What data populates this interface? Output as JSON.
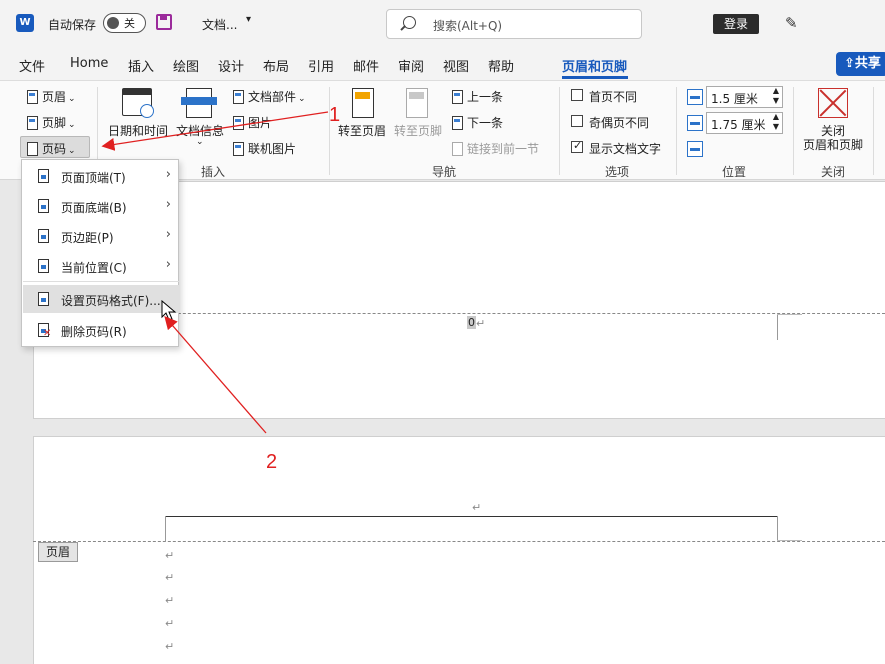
{
  "titlebar": {
    "app_letter": "W",
    "autosave_label": "自动保存",
    "autosave_state": "关",
    "doc_title": "文档...",
    "search_placeholder": "搜索(Alt+Q)",
    "login_label": "登录"
  },
  "tabs": [
    {
      "label": "文件"
    },
    {
      "label": "Home"
    },
    {
      "label": "插入"
    },
    {
      "label": "绘图"
    },
    {
      "label": "设计"
    },
    {
      "label": "布局"
    },
    {
      "label": "引用"
    },
    {
      "label": "邮件"
    },
    {
      "label": "审阅"
    },
    {
      "label": "视图"
    },
    {
      "label": "帮助"
    },
    {
      "label": "页眉和页脚",
      "active": true
    }
  ],
  "share_label": "共享",
  "ribbon": {
    "header_footer": {
      "header_label": "页眉",
      "footer_label": "页脚",
      "page_number_label": "页码"
    },
    "insert": {
      "datetime_label": "日期和时间",
      "docinfo_label": "文档信息",
      "quickparts_label": "文档部件",
      "picture_label": "图片",
      "online_picture_label": "联机图片",
      "group_label": "插入"
    },
    "navigation": {
      "goto_header_label": "转至页眉",
      "goto_footer_label": "转至页脚",
      "previous_label": "上一条",
      "next_label": "下一条",
      "link_previous_label": "链接到前一节",
      "group_label": "导航"
    },
    "options": {
      "different_first_label": "首页不同",
      "different_first_checked": false,
      "odd_even_label": "奇偶页不同",
      "odd_even_checked": false,
      "show_text_label": "显示文档文字",
      "show_text_checked": true,
      "group_label": "选项"
    },
    "position": {
      "header_top_value": "1.5 厘米",
      "footer_bottom_value": "1.75 厘米",
      "group_label": "位置"
    },
    "close": {
      "close_label_line1": "关闭",
      "close_label_line2": "页眉和页脚",
      "group_label": "关闭"
    }
  },
  "dropdown": {
    "items": [
      {
        "label": "页面顶端(T)",
        "has_submenu": true
      },
      {
        "label": "页面底端(B)",
        "has_submenu": true
      },
      {
        "label": "页边距(P)",
        "has_submenu": true
      },
      {
        "label": "当前位置(C)",
        "has_submenu": true
      },
      {
        "label": "设置页码格式(F)...",
        "has_submenu": false,
        "highlighted": true
      },
      {
        "label": "删除页码(R)",
        "has_submenu": false
      }
    ]
  },
  "document": {
    "page_number_field": "0",
    "paragraph_mark": "↵",
    "header_tag": "页眉"
  },
  "annotations": {
    "step1": "1",
    "step2": "2",
    "color": "#e02020"
  },
  "colors": {
    "accent": "#185abd",
    "close_red": "#c9302c",
    "header_yellow": "#f2a400"
  }
}
